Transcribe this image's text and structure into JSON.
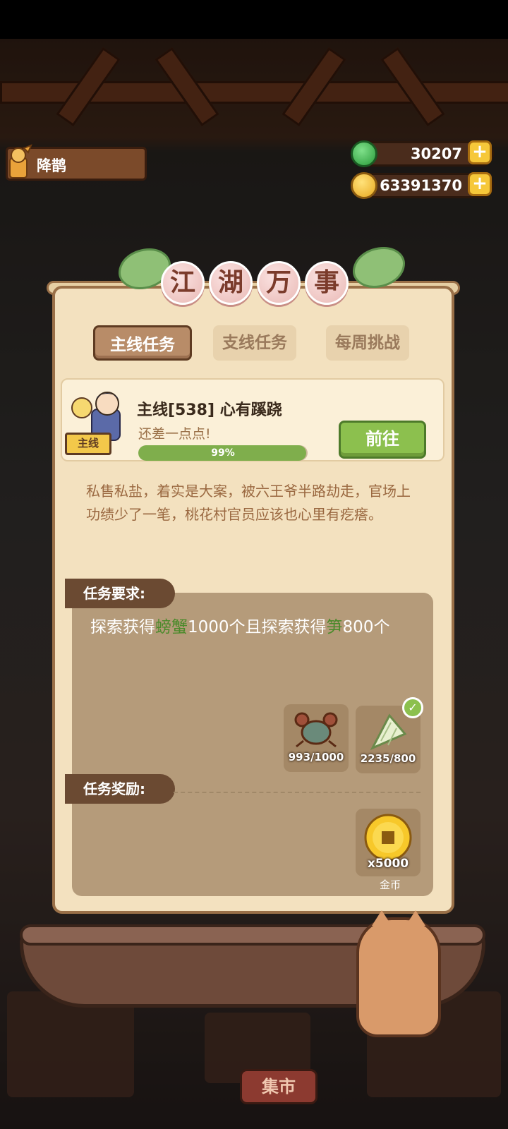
{
  "player": {
    "name": "降鹊"
  },
  "resources": {
    "jade": "30207",
    "coins": "63391370"
  },
  "panel": {
    "title_chars": [
      "江",
      "湖",
      "万",
      "事"
    ],
    "tabs": [
      {
        "label": "主线任务",
        "active": true
      },
      {
        "label": "支线任务",
        "active": false
      },
      {
        "label": "每周挑战",
        "active": false
      }
    ],
    "quest": {
      "tag": "主线",
      "title": "主线[538] 心有蹊跷",
      "subtitle": "还差一点点!",
      "progress_label": "99%",
      "progress": 0.99,
      "go_label": "前往"
    },
    "description": "私售私盐，着实是大案，被六王爷半路劫走，官场上功绩少了一笔，桃花村官员应该也心里有疙瘩。",
    "requirements": {
      "label": "任务要求:",
      "text_parts": [
        "探索获得",
        "螃蟹",
        "1000个且探索获得",
        "笋",
        "800个"
      ],
      "items": [
        {
          "icon": "crab-icon",
          "count": "993/1000",
          "done": false
        },
        {
          "icon": "bamboo-shoot-icon",
          "count": "2235/800",
          "done": true
        }
      ]
    },
    "rewards": {
      "label": "任务奖励:",
      "items": [
        {
          "icon": "gold-coin-icon",
          "amount": "x5000",
          "name": "金币"
        }
      ]
    }
  },
  "bottom": {
    "market_label": "集市"
  },
  "colors": {
    "accent_green": "#8cc04e",
    "panel_bg": "#f3e1bf",
    "label_brown": "#6b4a32"
  }
}
